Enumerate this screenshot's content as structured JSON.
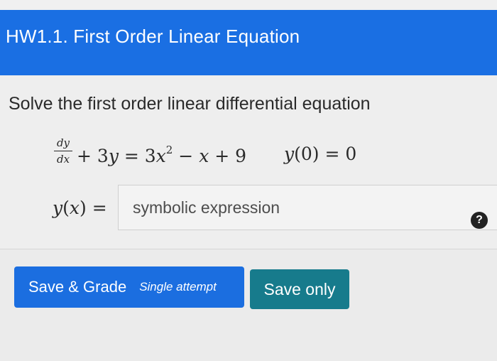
{
  "header": {
    "title": "HW1.1. First Order Linear Equation"
  },
  "question": {
    "prompt": "Solve the first order linear differential equation",
    "equation": {
      "numerator": "dy",
      "denominator": "dx",
      "rhs_part1": "+ 3",
      "var_y": "y",
      "rhs_part2": " = 3",
      "var_x": "x",
      "exponent": "2",
      "rhs_part3": " − ",
      "var_x2": "x",
      "rhs_part4": " + 9"
    },
    "initial_condition": {
      "var": "y",
      "rest": "(0) = 0"
    },
    "answer": {
      "label_var": "y",
      "label_paren_open": "(",
      "label_arg": "x",
      "label_rest": ") =",
      "placeholder": "symbolic expression",
      "value": ""
    },
    "help_icon": "question-circle-icon",
    "help_symbol": "?"
  },
  "footer": {
    "grade_button_label": "Save & Grade",
    "grade_button_sub": "Single attempt",
    "save_button_label": "Save only"
  },
  "colors": {
    "header_bg": "#1a6fe3",
    "grade_button_bg": "#1b6ee0",
    "save_button_bg": "#177b8c"
  }
}
